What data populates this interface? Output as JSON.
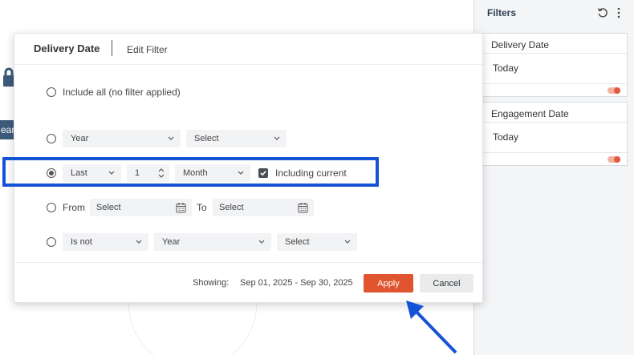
{
  "background": {
    "tag_text": "ear"
  },
  "panel": {
    "title": "Filters",
    "reset_icon": "refresh-icon",
    "more_icon": "more-vertical-icon",
    "cards": [
      {
        "title": "Delivery Date",
        "value": "Today"
      },
      {
        "title": "Engagement Date",
        "value": "Today"
      }
    ]
  },
  "modal": {
    "title": "Delivery Date",
    "tab": "Edit Filter",
    "options": {
      "include_all": "Include all (no filter applied)",
      "year_row": {
        "period": "Year",
        "select": "Select"
      },
      "last_row": {
        "mode": "Last",
        "count": "1",
        "unit": "Month",
        "including_current": "Including current",
        "including_current_checked": true
      },
      "from_row": {
        "from_label": "From",
        "from_placeholder": "Select",
        "to_label": "To",
        "to_placeholder": "Select"
      },
      "isnot_row": {
        "operator": "Is not",
        "period": "Year",
        "select": "Select"
      }
    },
    "selected_option": "last_row",
    "footer": {
      "showing_label": "Showing:",
      "showing_range": "Sep 01, 2025 - Sep 30, 2025",
      "apply_label": "Apply",
      "cancel_label": "Cancel"
    }
  },
  "colors": {
    "accent": "#e0552f",
    "highlight": "#1553d6",
    "arrow": "#1553d6"
  }
}
